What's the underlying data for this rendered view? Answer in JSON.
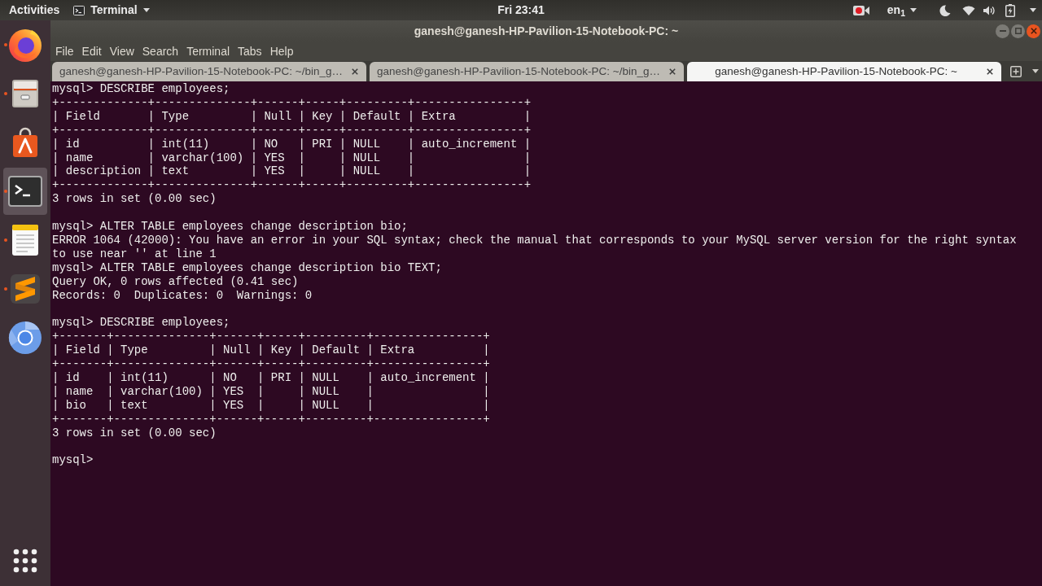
{
  "top_bar": {
    "activities": "Activities",
    "app_menu": "Terminal",
    "clock": "Fri 23:41",
    "keyboard_layout": "en$_{1}$"
  },
  "dock": {
    "items": [
      {
        "kind": "browser",
        "running": true,
        "selected": false
      },
      {
        "kind": "files",
        "running": true,
        "selected": false
      },
      {
        "kind": "store",
        "running": false,
        "selected": false
      },
      {
        "kind": "terminal",
        "running": true,
        "selected": true
      },
      {
        "kind": "notes",
        "running": true,
        "selected": false
      },
      {
        "kind": "editor",
        "running": true,
        "selected": false
      },
      {
        "kind": "web",
        "running": false,
        "selected": false
      }
    ]
  },
  "window": {
    "title": "ganesh@ganesh-HP-Pavilion-15-Notebook-PC: ~",
    "menu": [
      "File",
      "Edit",
      "View",
      "Search",
      "Terminal",
      "Tabs",
      "Help"
    ],
    "tabs": [
      {
        "label": "ganesh@ganesh-HP-Pavilion-15-Notebook-PC: ~/bin_g…",
        "selected": false
      },
      {
        "label": "ganesh@ganesh-HP-Pavilion-15-Notebook-PC: ~/bin_g…",
        "selected": false
      },
      {
        "label": "ganesh@ganesh-HP-Pavilion-15-Notebook-PC: ~",
        "selected": true
      }
    ],
    "terminal": {
      "blocks": [
        [
          "mysql> DESCRIBE employees;",
          "+-------------+--------------+------+-----+---------+----------------+",
          "| Field       | Type         | Null | Key | Default | Extra          |",
          "+-------------+--------------+------+-----+---------+----------------+",
          "| id          | int(11)      | NO   | PRI | NULL    | auto_increment |",
          "| name        | varchar(100) | YES  |     | NULL    |                |",
          "| description | text         | YES  |     | NULL    |                |",
          "+-------------+--------------+------+-----+---------+----------------+",
          "3 rows in set (0.00 sec)"
        ],
        [
          "mysql> ALTER TABLE employees change description bio;",
          "ERROR 1064 (42000): You have an error in your SQL syntax; check the manual that corresponds to your MySQL server version for the right syntax",
          "to use near '' at line 1",
          "mysql> ALTER TABLE employees change description bio TEXT;",
          "Query OK, 0 rows affected (0.41 sec)",
          "Records: 0  Duplicates: 0  Warnings: 0"
        ],
        [
          "mysql> DESCRIBE employees;",
          "+-------+--------------+------+-----+---------+----------------+",
          "| Field | Type         | Null | Key | Default | Extra          |",
          "+-------+--------------+------+-----+---------+----------------+",
          "| id    | int(11)      | NO   | PRI | NULL    | auto_increment |",
          "| name  | varchar(100) | YES  |     | NULL    |                |",
          "| bio   | text         | YES  |     | NULL    |                |",
          "+-------+--------------+------+-----+---------+----------------+",
          "3 rows in set (0.00 sec)"
        ],
        [
          "mysql> "
        ]
      ]
    }
  }
}
